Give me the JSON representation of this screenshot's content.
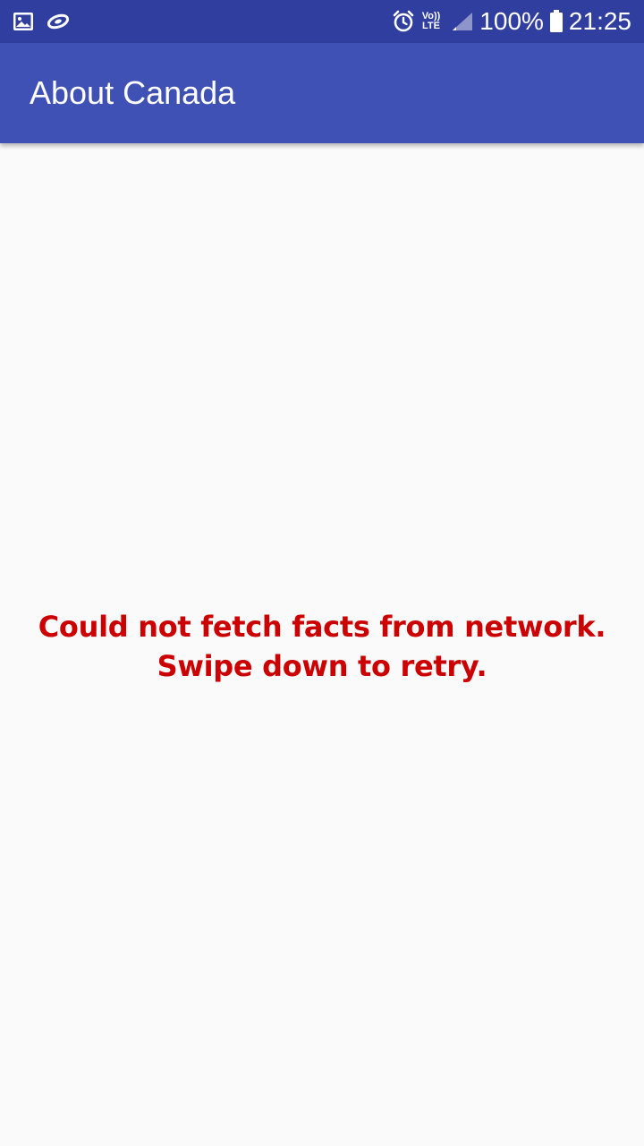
{
  "status_bar": {
    "icons_left": [
      "gallery-icon",
      "sync-icon"
    ],
    "icons_right": [
      "alarm-icon",
      "volte-icon",
      "signal-icon"
    ],
    "volte_top": "Vo))",
    "volte_bottom": "LTE",
    "battery_percent": "100%",
    "battery_level": 1.0,
    "time": "21:25",
    "background_color": "#303f9f"
  },
  "app_bar": {
    "title": "About Canada",
    "background_color": "#3f51b5"
  },
  "content": {
    "error_line_1": "Could not fetch facts from network.",
    "error_line_2": "Swipe down to retry.",
    "error_color": "#cc0000"
  }
}
